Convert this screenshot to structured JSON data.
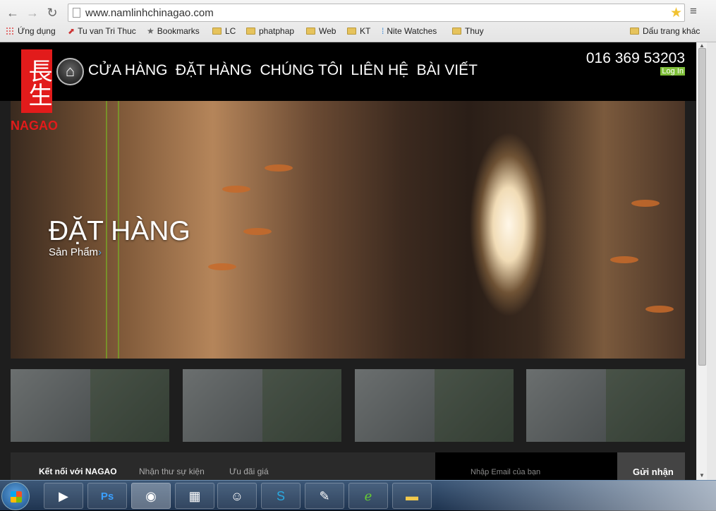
{
  "browser": {
    "url": "www.namlinhchinagao.com",
    "bookmarks": [
      {
        "label": "Ứng dụng",
        "icon": "apps-icon"
      },
      {
        "label": "Tu van Tri Thuc",
        "icon": "bookmark-page-icon"
      },
      {
        "label": "Bookmarks",
        "icon": "star-icon"
      },
      {
        "label": "LC",
        "icon": "folder-icon"
      },
      {
        "label": "phatphap",
        "icon": "folder-icon"
      },
      {
        "label": "Web",
        "icon": "folder-icon"
      },
      {
        "label": "KT",
        "icon": "folder-icon"
      },
      {
        "label": "Nite Watches",
        "icon": "bookmark-page-icon"
      },
      {
        "label": "Thuy",
        "icon": "folder-icon"
      },
      {
        "label": "Dấu trang khác",
        "icon": "folder-icon"
      }
    ]
  },
  "site": {
    "logo_glyph": "長生",
    "logo_text": "NAGAO",
    "nav": [
      "CỬA HÀNG",
      "ĐẶT HÀNG",
      "CHÚNG TÔI",
      "LIÊN HỆ",
      "BÀI VIẾT"
    ],
    "phone": "016 369 53203",
    "login": "Log In",
    "hero_title": "ĐẶT HÀNG",
    "hero_subtitle": "Sản Phẩm",
    "hero_arrow": "›",
    "footer": {
      "connect": "Kết nối với NAGAO",
      "newsletter": "Nhận thư sự kiện",
      "offers": "Ưu đãi giá",
      "email_hint": "Nhập Email của bạn",
      "signup": "Gửi nhận"
    },
    "colors": {
      "brand_red": "#e21b1b",
      "login_green": "#7fbf3a"
    }
  },
  "taskbar": {
    "apps": [
      "media-player-icon",
      "photoshop-icon",
      "chrome-icon",
      "calculator-icon",
      "messenger-icon",
      "skype-icon",
      "notepad-icon",
      "dreamweaver-icon",
      "explorer-icon"
    ]
  }
}
